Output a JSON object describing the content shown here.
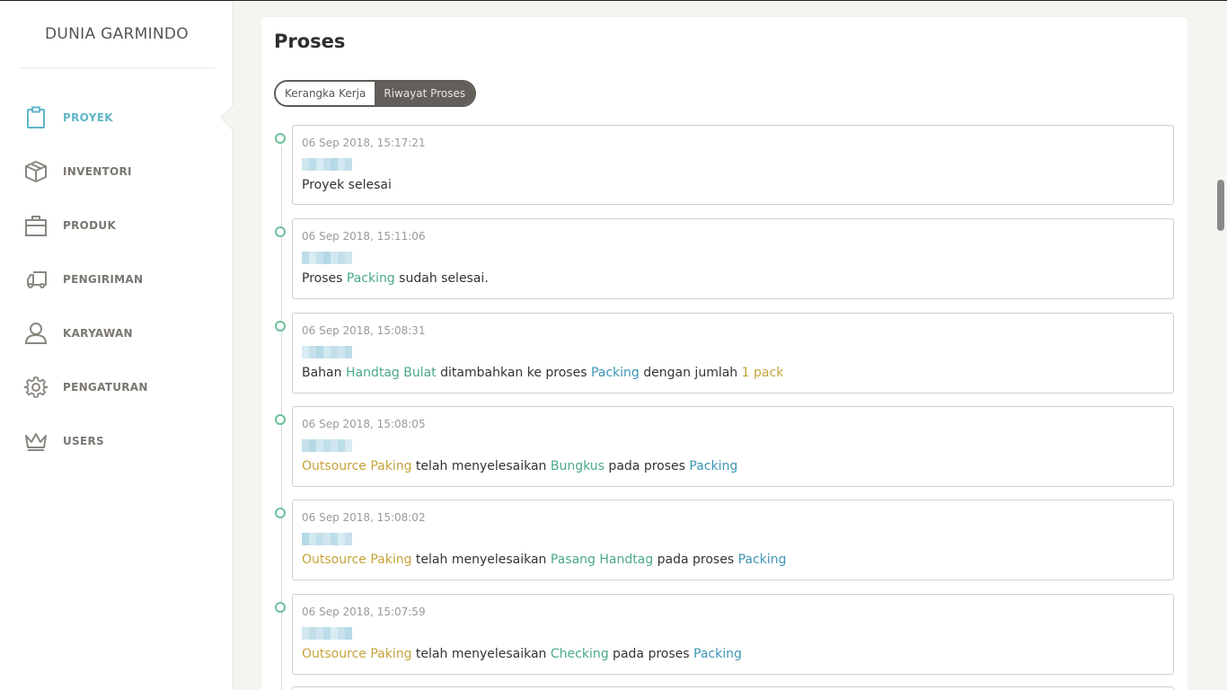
{
  "brand": "DUNIA GARMINDO",
  "nav": [
    {
      "label": "PROYEK",
      "icon": "clipboard-icon",
      "active": true
    },
    {
      "label": "INVENTORI",
      "icon": "box-icon",
      "active": false
    },
    {
      "label": "PRODUK",
      "icon": "briefcase-icon",
      "active": false
    },
    {
      "label": "PENGIRIMAN",
      "icon": "truck-icon",
      "active": false
    },
    {
      "label": "KARYAWAN",
      "icon": "user-icon",
      "active": false
    },
    {
      "label": "PENGATURAN",
      "icon": "gear-icon",
      "active": false
    },
    {
      "label": "USERS",
      "icon": "crown-icon",
      "active": false
    }
  ],
  "page": {
    "title": "Proses",
    "toggle": [
      {
        "label": "Kerangka Kerja",
        "active": false
      },
      {
        "label": "Riwayat Proses",
        "active": true
      }
    ]
  },
  "entries": [
    {
      "time": "06 Sep 2018, 15:17:21",
      "parts": [
        {
          "t": "Proyek selesai",
          "c": ""
        }
      ]
    },
    {
      "time": "06 Sep 2018, 15:11:06",
      "parts": [
        {
          "t": "Proses ",
          "c": ""
        },
        {
          "t": "Packing",
          "c": "green"
        },
        {
          "t": " sudah selesai.",
          "c": ""
        }
      ]
    },
    {
      "time": "06 Sep 2018, 15:08:31",
      "parts": [
        {
          "t": "Bahan ",
          "c": ""
        },
        {
          "t": "Handtag Bulat",
          "c": "green"
        },
        {
          "t": " ditambahkan ke proses ",
          "c": ""
        },
        {
          "t": "Packing",
          "c": "blue"
        },
        {
          "t": " dengan jumlah ",
          "c": ""
        },
        {
          "t": "1 pack",
          "c": "gold"
        }
      ]
    },
    {
      "time": "06 Sep 2018, 15:08:05",
      "parts": [
        {
          "t": "Outsource Paking",
          "c": "gold"
        },
        {
          "t": " telah menyelesaikan ",
          "c": ""
        },
        {
          "t": "Bungkus",
          "c": "green"
        },
        {
          "t": " pada proses ",
          "c": ""
        },
        {
          "t": "Packing",
          "c": "blue"
        }
      ]
    },
    {
      "time": "06 Sep 2018, 15:08:02",
      "parts": [
        {
          "t": "Outsource Paking",
          "c": "gold"
        },
        {
          "t": " telah menyelesaikan ",
          "c": ""
        },
        {
          "t": "Pasang Handtag",
          "c": "green"
        },
        {
          "t": " pada proses ",
          "c": ""
        },
        {
          "t": "Packing",
          "c": "blue"
        }
      ]
    },
    {
      "time": "06 Sep 2018, 15:07:59",
      "parts": [
        {
          "t": "Outsource Paking",
          "c": "gold"
        },
        {
          "t": " telah menyelesaikan ",
          "c": ""
        },
        {
          "t": "Checking",
          "c": "green"
        },
        {
          "t": " pada proses ",
          "c": ""
        },
        {
          "t": "Packing",
          "c": "blue"
        }
      ]
    }
  ],
  "colors": {
    "accent": "#5fb6c7",
    "green": "#4aa88a",
    "blue": "#3c95b5",
    "gold": "#c6a33a",
    "dot": "#6cc19a"
  }
}
